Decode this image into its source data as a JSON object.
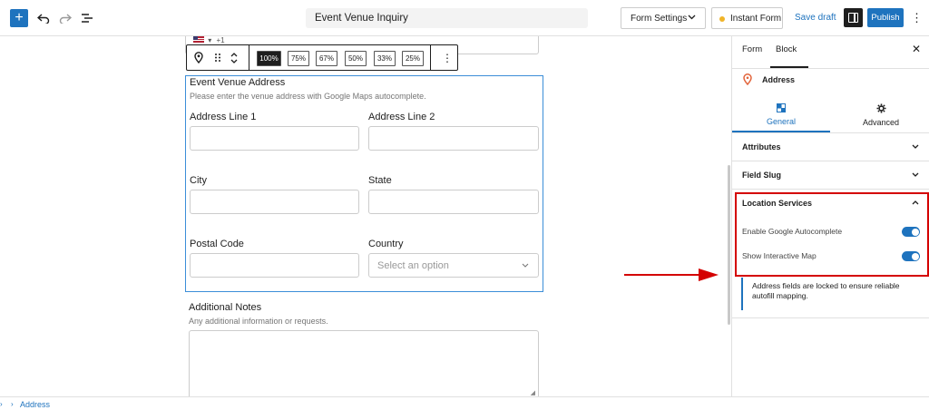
{
  "topbar": {
    "document_title": "Event Venue Inquiry",
    "form_settings_label": "Form Settings",
    "instant_form_label": "Instant Form",
    "save_draft_label": "Save draft",
    "publish_label": "Publish"
  },
  "block_toolbar": {
    "width_options": [
      "100%",
      "75%",
      "67%",
      "50%",
      "33%",
      "25%"
    ],
    "active_width": "100%",
    "phone_prefix": "+1"
  },
  "address_block": {
    "title": "Event Venue Address",
    "description": "Please enter the venue address with Google Maps autocomplete.",
    "fields": {
      "line1": "Address Line 1",
      "line2": "Address Line 2",
      "city": "City",
      "state": "State",
      "postal": "Postal Code",
      "country": "Country"
    },
    "country_placeholder": "Select an option"
  },
  "notes_block": {
    "title": "Additional Notes",
    "description": "Any additional information or requests."
  },
  "panel": {
    "tabs": [
      "Form",
      "Block"
    ],
    "active_tab": "Block",
    "block_name": "Address",
    "segment_tabs": [
      "General",
      "Advanced"
    ],
    "active_segment": "General",
    "sections": {
      "attributes": "Attributes",
      "field_slug": "Field Slug",
      "location_services": "Location Services"
    },
    "location_options": [
      {
        "label": "Enable Google Autocomplete",
        "enabled": true
      },
      {
        "label": "Show Interactive Map",
        "enabled": true
      }
    ],
    "note": "Address fields are locked to ensure reliable autofill mapping."
  },
  "footer": {
    "breadcrumb": "Address"
  },
  "colors": {
    "accent": "#1e73be",
    "highlight": "#d40000",
    "selection": "#3b8ed8"
  }
}
